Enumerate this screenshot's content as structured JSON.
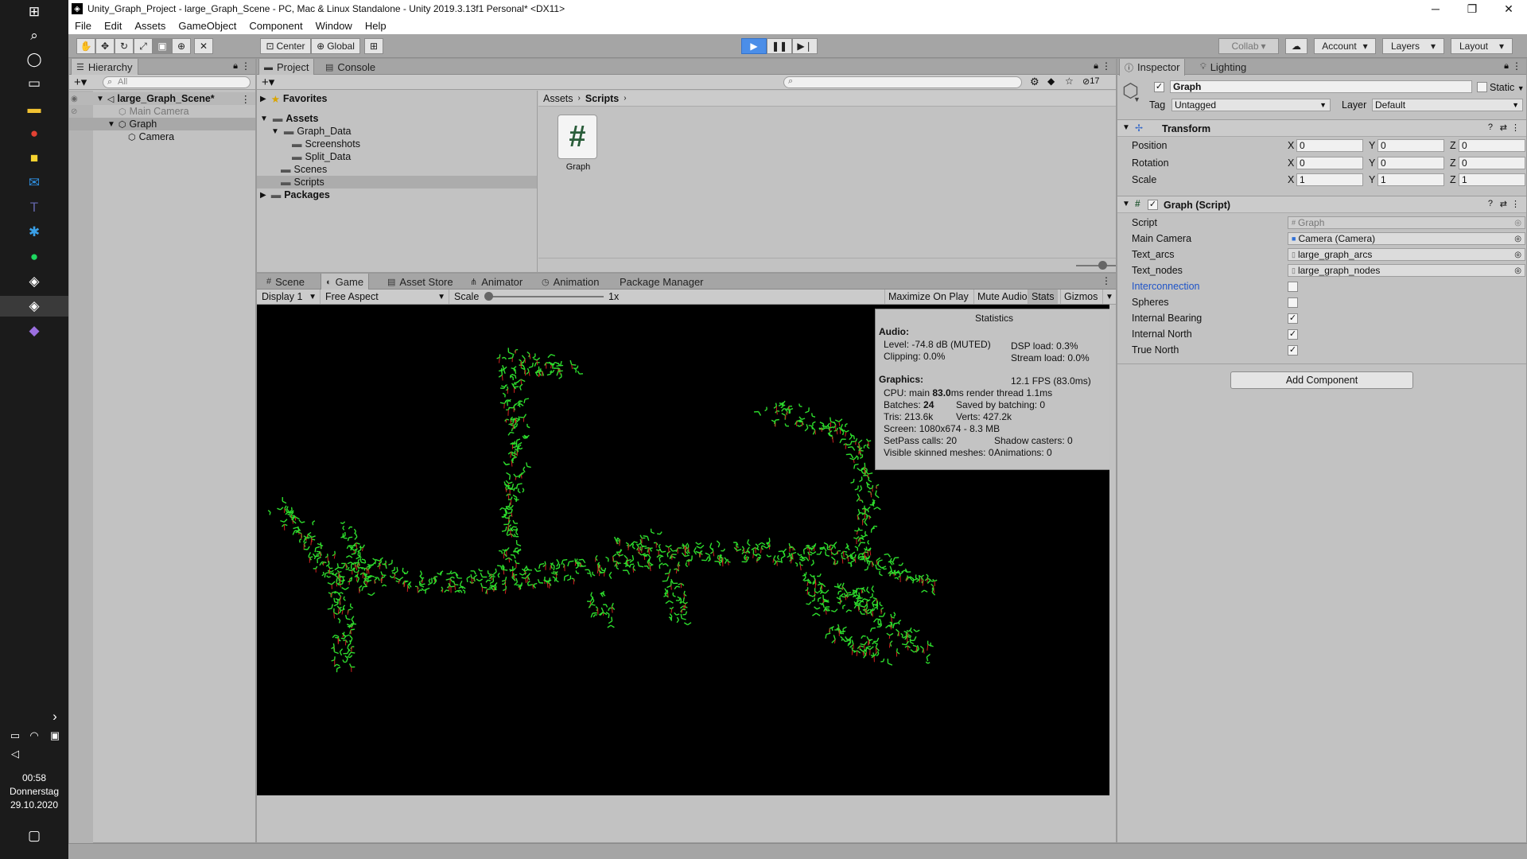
{
  "taskbar": {
    "time": "00:58",
    "day": "Donnerstag",
    "date": "29.10.2020"
  },
  "window": {
    "title": "Unity_Graph_Project - large_Graph_Scene - PC, Mac & Linux Standalone - Unity 2019.3.13f1 Personal* <DX11>"
  },
  "menu": [
    "File",
    "Edit",
    "Assets",
    "GameObject",
    "Component",
    "Window",
    "Help"
  ],
  "toolbar": {
    "pivot": "Center",
    "space": "Global",
    "collab": "Collab",
    "account": "Account",
    "layers": "Layers",
    "layout": "Layout"
  },
  "hierarchy": {
    "tab": "Hierarchy",
    "search_placeholder": "All",
    "scene": "large_Graph_Scene*",
    "items": [
      "Main Camera",
      "Graph",
      "Camera"
    ]
  },
  "project": {
    "tabs": [
      "Project",
      "Console"
    ],
    "hidden_count": "17",
    "favorites": "Favorites",
    "assets": "Assets",
    "tree": [
      "Graph_Data",
      "Screenshots",
      "Split_Data",
      "Scenes",
      "Scripts"
    ],
    "packages": "Packages",
    "breadcrumb": [
      "Assets",
      "Scripts"
    ],
    "asset_name": "Graph"
  },
  "game": {
    "tabs": [
      "Scene",
      "Game",
      "Asset Store",
      "Animator",
      "Animation",
      "Package Manager"
    ],
    "display": "Display 1",
    "aspect": "Free Aspect",
    "scale_label": "Scale",
    "scale_value": "1x",
    "buttons": [
      "Maximize On Play",
      "Mute Audio",
      "Stats",
      "Gizmos"
    ]
  },
  "stats": {
    "title": "Statistics",
    "audio_h": "Audio:",
    "level": "Level: -74.8 dB (MUTED)",
    "dsp": "DSP load: 0.3%",
    "clipping": "Clipping: 0.0%",
    "stream": "Stream load: 0.0%",
    "graphics_h": "Graphics:",
    "fps": "12.1 FPS (83.0ms)",
    "cpu_a": "CPU: main ",
    "cpu_b": "83.0",
    "cpu_c": "ms  render thread 1.1ms",
    "batches_a": "Batches: ",
    "batches_b": "24",
    "saved": "Saved by batching: 0",
    "tris": "Tris: 213.6k",
    "verts": "Verts: 427.2k",
    "screen": "Screen: 1080x674 - 8.3 MB",
    "setpass": "SetPass calls: 20",
    "shadow": "Shadow casters: 0",
    "skinned": "Visible skinned meshes: 0",
    "anims": "Animations: 0"
  },
  "inspector": {
    "tabs": [
      "Inspector",
      "Lighting"
    ],
    "object_name": "Graph",
    "static": "Static",
    "tag_label": "Tag",
    "tag_value": "Untagged",
    "layer_label": "Layer",
    "layer_value": "Default",
    "transform": {
      "title": "Transform",
      "rows": [
        {
          "label": "Position",
          "x": "0",
          "y": "0",
          "z": "0"
        },
        {
          "label": "Rotation",
          "x": "0",
          "y": "0",
          "z": "0"
        },
        {
          "label": "Scale",
          "x": "1",
          "y": "1",
          "z": "1"
        }
      ]
    },
    "graph_script": {
      "title": "Graph (Script)",
      "script_label": "Script",
      "script_value": "Graph",
      "main_camera_label": "Main Camera",
      "main_camera_value": "Camera (Camera)",
      "text_arcs_label": "Text_arcs",
      "text_arcs_value": "large_graph_arcs",
      "text_nodes_label": "Text_nodes",
      "text_nodes_value": "large_graph_nodes",
      "toggles": [
        {
          "label": "Interconnection",
          "checked": false
        },
        {
          "label": "Spheres",
          "checked": false
        },
        {
          "label": "Internal Bearing",
          "checked": true
        },
        {
          "label": "Internal North",
          "checked": true
        },
        {
          "label": "True North",
          "checked": true
        }
      ]
    },
    "add_component": "Add Component"
  },
  "colors": {
    "accent": "#4b8ee8",
    "graph_nodes": "#2dde2d",
    "graph_arcs": "#d22020",
    "link_blue": "#1f54c8"
  }
}
